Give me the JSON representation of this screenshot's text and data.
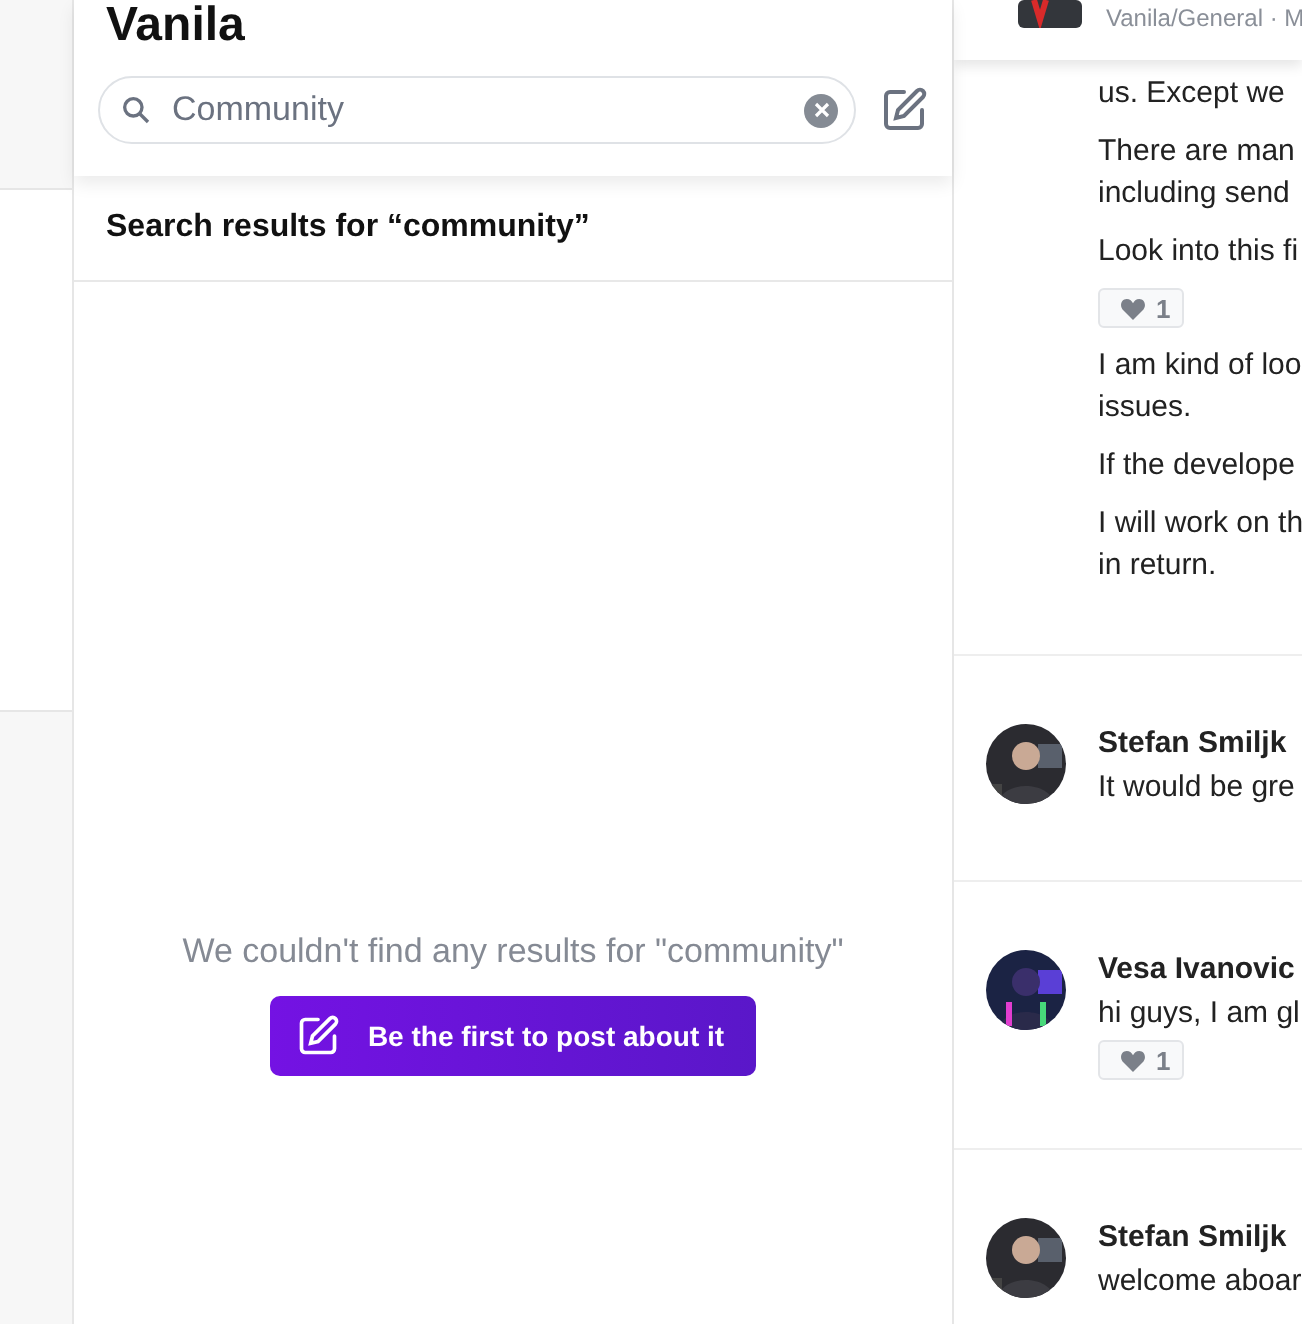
{
  "header": {
    "title": "Vanila",
    "search": {
      "value": "Community"
    }
  },
  "results": {
    "heading": "Search results for “community”",
    "empty_message": "We couldn't find any results for \"community\"",
    "button": "Be the first to post about it"
  },
  "thread": {
    "channel": "Vanila/General · M",
    "first_message": {
      "blocks": [
        {
          "kind": "text",
          "lines": [
            "us. Except we"
          ]
        },
        {
          "kind": "text",
          "lines": [
            "There are man",
            "including send"
          ]
        },
        {
          "kind": "text",
          "lines": [
            "Look into this fi"
          ]
        },
        {
          "kind": "reaction",
          "count": "1"
        },
        {
          "kind": "text",
          "lines": [
            "I am kind of loo",
            "issues."
          ]
        },
        {
          "kind": "text",
          "lines": [
            "If the develope"
          ]
        },
        {
          "kind": "text",
          "lines": [
            "I will work on th",
            "in return."
          ]
        }
      ]
    },
    "messages": [
      {
        "author": "Stefan Smiljk",
        "text": "It would be gre"
      },
      {
        "author": "Vesa Ivanovic",
        "text": "hi guys, I am gl",
        "reaction": "1"
      },
      {
        "author": "Stefan Smiljk",
        "text": "welcome aboar"
      }
    ]
  }
}
